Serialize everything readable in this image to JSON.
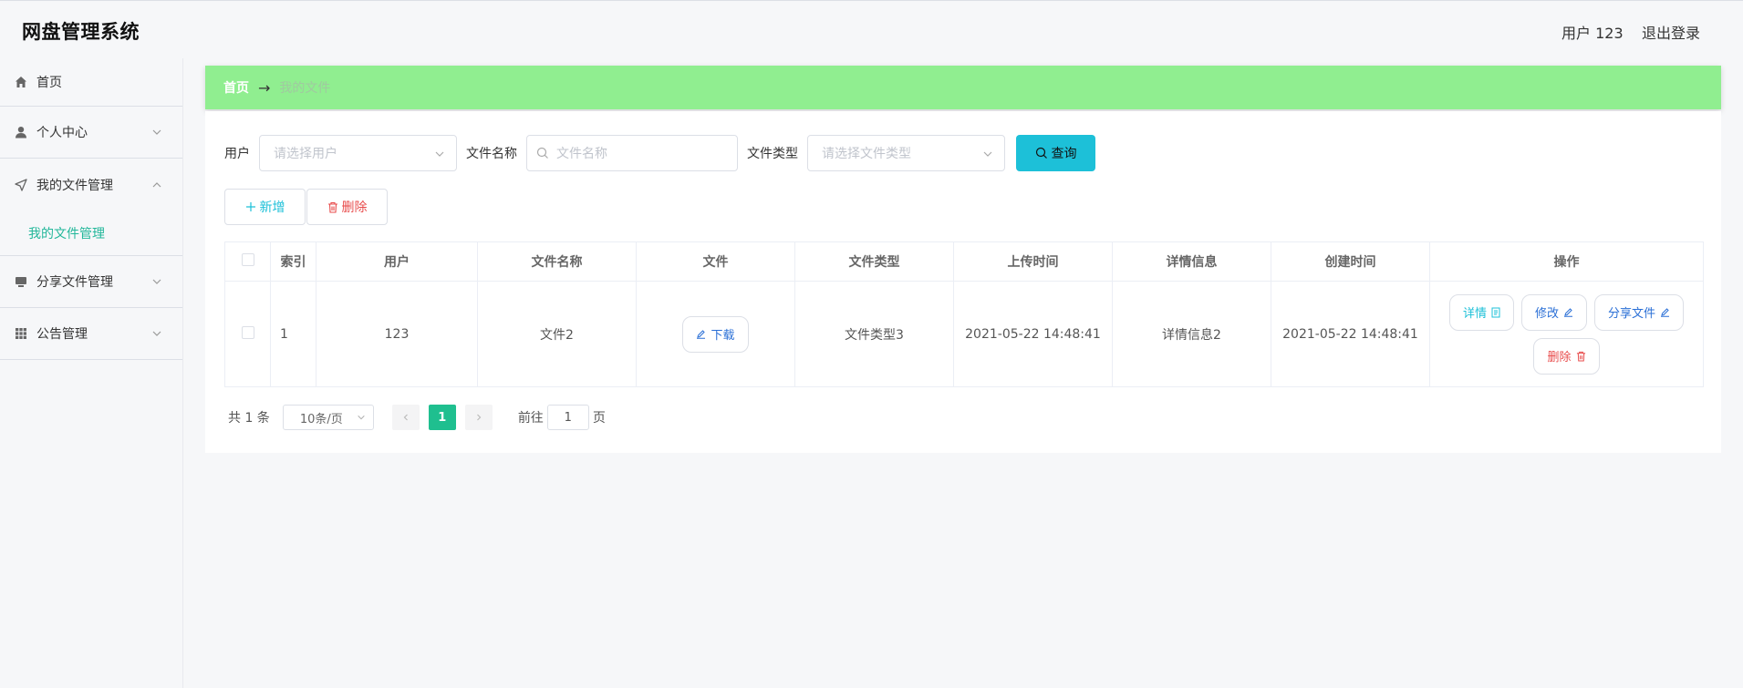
{
  "header": {
    "app_title": "网盘管理系统",
    "user_label": "用户 123",
    "logout_label": "退出登录"
  },
  "sidebar": {
    "items": [
      {
        "label": "首页",
        "icon": "home-icon"
      },
      {
        "label": "个人中心",
        "icon": "user-icon"
      },
      {
        "label": "我的文件管理",
        "icon": "send-icon"
      },
      {
        "label": "分享文件管理",
        "icon": "monitor-icon"
      },
      {
        "label": "公告管理",
        "icon": "grid-icon"
      }
    ],
    "submenu_label": "我的文件管理"
  },
  "breadcrumb": {
    "home": "首页",
    "separator": "→",
    "current": "我的文件"
  },
  "search": {
    "user_label": "用户",
    "user_placeholder": "请选择用户",
    "name_label": "文件名称",
    "name_placeholder": "文件名称",
    "type_label": "文件类型",
    "type_placeholder": "请选择文件类型",
    "query_label": "查询"
  },
  "actions": {
    "add_label": "新增",
    "delete_label": "删除"
  },
  "table": {
    "headers": [
      "索引",
      "用户",
      "文件名称",
      "文件",
      "文件类型",
      "上传时间",
      "详情信息",
      "创建时间",
      "操作"
    ],
    "rows": [
      {
        "index": "1",
        "user": "123",
        "file_name": "文件2",
        "download_label": "下载",
        "file_type": "文件类型3",
        "upload_time": "2021-05-22 14:48:41",
        "detail_info": "详情信息2",
        "create_time": "2021-05-22 14:48:41",
        "op_detail": "详情",
        "op_edit": "修改",
        "op_share": "分享文件",
        "op_delete": "删除"
      }
    ]
  },
  "pager": {
    "total": "共 1 条",
    "page_size": "10条/页",
    "current": "1",
    "goto_label": "前往",
    "goto_value": "1",
    "page_suffix": "页"
  },
  "colors": {
    "breadcrumb_bg": "#90ee90",
    "accent": "#1dc0d8",
    "active_page": "#1fbf8f",
    "danger": "#e84c4c"
  }
}
